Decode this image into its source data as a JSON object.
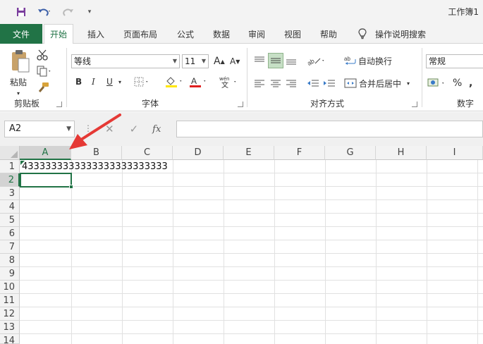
{
  "titlebar": {
    "workbook_title": "工作簿1"
  },
  "tabs": {
    "file": "文件",
    "items": [
      "开始",
      "插入",
      "页面布局",
      "公式",
      "数据",
      "审阅",
      "视图",
      "帮助"
    ],
    "tell_me": "操作说明搜索"
  },
  "ribbon": {
    "clipboard": {
      "paste": "粘贴",
      "label": "剪贴板"
    },
    "font": {
      "name": "等线",
      "size": "11",
      "label": "字体",
      "bold": "B",
      "italic": "I",
      "underline": "U",
      "grow": "A",
      "shrink": "A"
    },
    "alignment": {
      "wrap": "自动换行",
      "merge": "合并后居中",
      "label": "对齐方式"
    },
    "number": {
      "format": "常规",
      "percent": "%",
      "label": "数字"
    }
  },
  "formula_bar": {
    "name_box": "A2",
    "fx": "fx",
    "formula": ""
  },
  "grid": {
    "columns": [
      "A",
      "B",
      "C",
      "D",
      "E",
      "F",
      "G",
      "H",
      "I"
    ],
    "rows": [
      "1",
      "2",
      "3",
      "4",
      "5",
      "6",
      "7",
      "8",
      "9",
      "10",
      "11",
      "12",
      "13",
      "14"
    ],
    "selected_column": "A",
    "selected_row": "2",
    "cell_a1": "4333333333333333333333333"
  },
  "colors": {
    "accent": "#217346",
    "annotation_arrow": "#e53935"
  }
}
